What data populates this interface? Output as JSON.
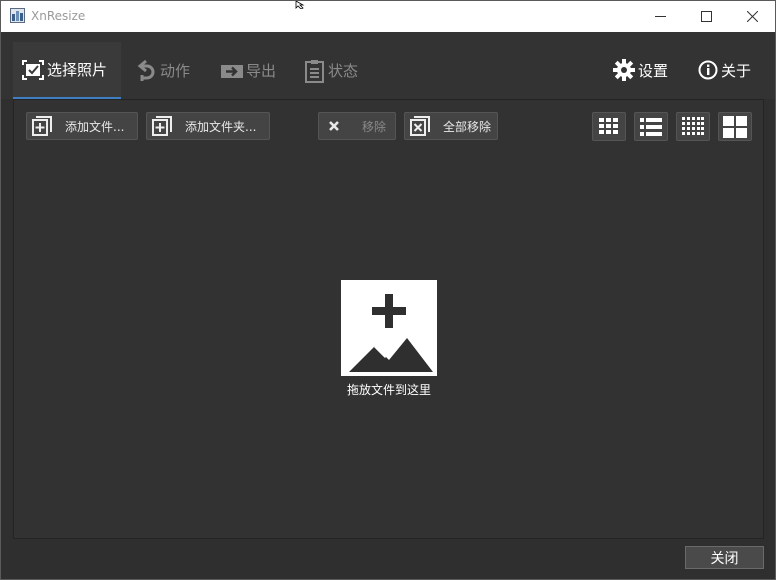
{
  "window": {
    "title": "XnResize",
    "minimize_label": "minimize",
    "maximize_label": "maximize",
    "close_label": "close"
  },
  "tabs": [
    {
      "label": "选择照片",
      "icon": "select-photos-icon",
      "active": true
    },
    {
      "label": "动作",
      "icon": "action-icon",
      "active": false
    },
    {
      "label": "导出",
      "icon": "export-icon",
      "active": false
    },
    {
      "label": "状态",
      "icon": "status-icon",
      "active": false
    }
  ],
  "header_right": {
    "settings_label": "设置",
    "about_label": "关于"
  },
  "toolbar": {
    "add_files_label": "添加文件...",
    "add_folder_label": "添加文件夹...",
    "remove_label": "移除",
    "remove_all_label": "全部移除"
  },
  "view_modes": [
    "grid-small-icon",
    "list-icon",
    "grid-dense-icon",
    "grid-large-icon"
  ],
  "drop_zone": {
    "label": "拖放文件到这里"
  },
  "footer": {
    "close_label": "关闭"
  },
  "colors": {
    "background": "#2f2f2f",
    "accent": "#3d7fc2",
    "button": "#444444"
  }
}
